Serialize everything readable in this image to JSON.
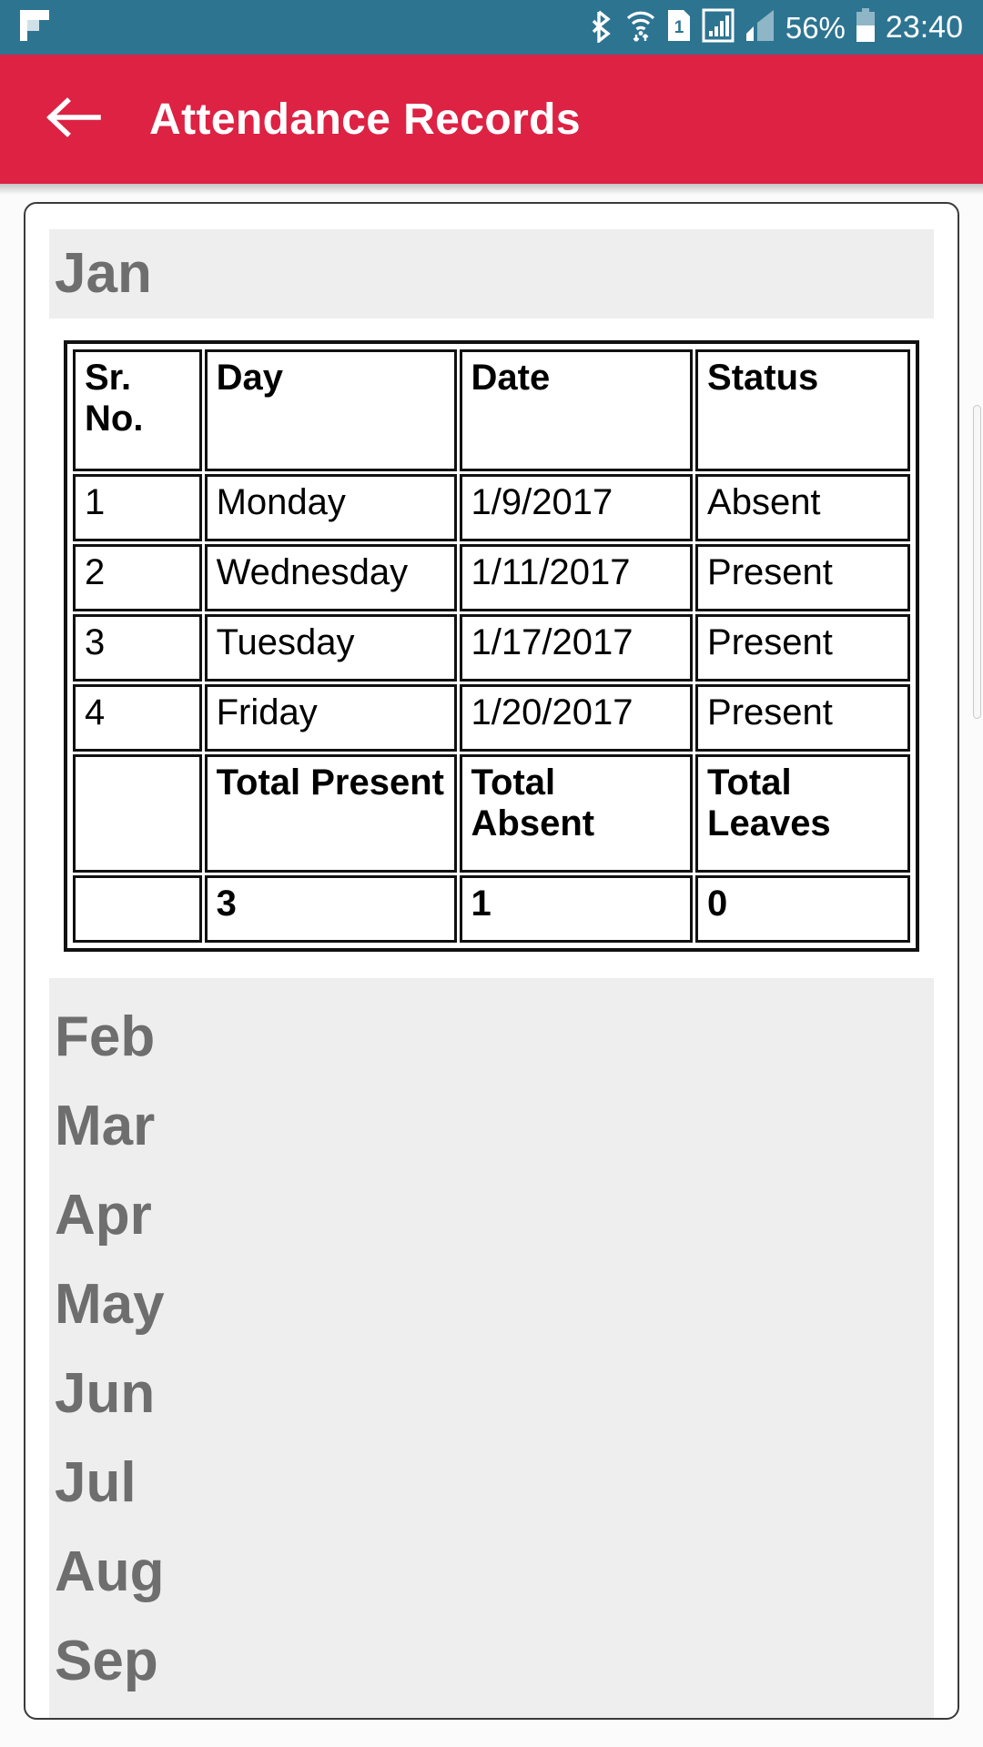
{
  "status_bar": {
    "background": "#2d7491",
    "app_icon": "flipboard-icon",
    "icons": [
      "bluetooth-icon",
      "wifi-icon",
      "sim-card-1-icon",
      "signal-boxed-icon",
      "signal-bars-icon"
    ],
    "sim_label": "1",
    "battery_percent": "56%",
    "time": "23:40"
  },
  "appbar": {
    "background": "#dd2244",
    "back_icon": "arrow-left-icon",
    "title": "Attendance Records"
  },
  "month_section": {
    "label": "Jan",
    "table": {
      "headers": [
        "Sr. No.",
        "Day",
        "Date",
        "Status"
      ],
      "rows": [
        [
          "1",
          "Monday",
          "1/9/2017",
          "Absent"
        ],
        [
          "2",
          "Wednesday",
          "1/11/2017",
          "Present"
        ],
        [
          "3",
          "Tuesday",
          "1/17/2017",
          "Present"
        ],
        [
          "4",
          "Friday",
          "1/20/2017",
          "Present"
        ]
      ],
      "summary_labels": [
        "",
        "Total Present",
        "Total Absent",
        "Total Leaves"
      ],
      "summary_values": [
        "",
        "3",
        "1",
        "0"
      ]
    }
  },
  "month_list": {
    "items": [
      "Feb",
      "Mar",
      "Apr",
      "May",
      "Jun",
      "Jul",
      "Aug",
      "Sep"
    ]
  },
  "colors": {
    "status_bar": "#2d7491",
    "accent_red": "#dd2244",
    "month_bg": "#eeeeee",
    "month_text": "#6e6e6e",
    "table_border": "#111111"
  }
}
